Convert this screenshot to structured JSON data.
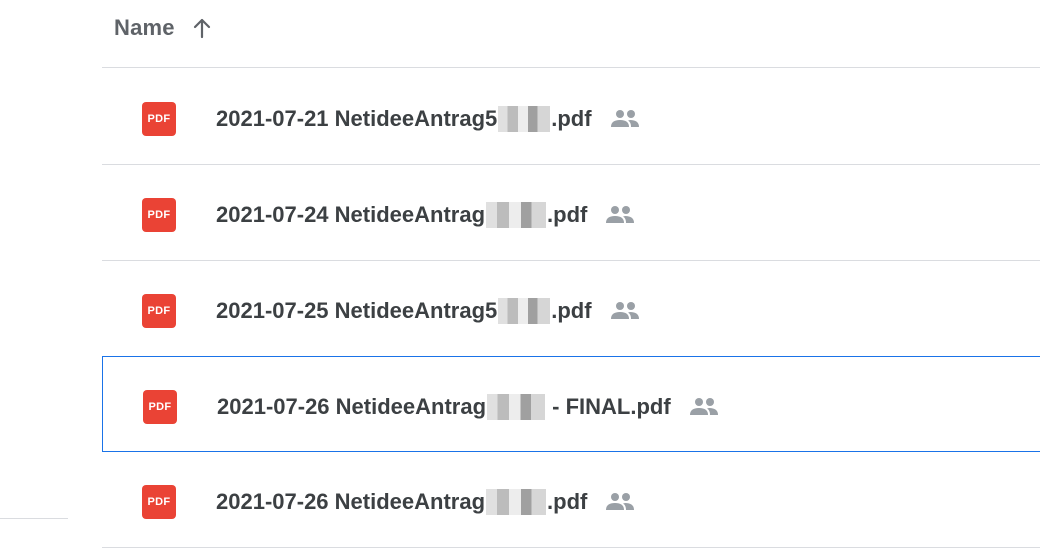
{
  "header": {
    "sort_label": "Name",
    "sort_icon": "arrow-up-icon"
  },
  "files": [
    {
      "prefix": "2021-07-21 NetideeAntrag5",
      "suffix": ".pdf",
      "type_label": "PDF",
      "shared": true,
      "selected": false
    },
    {
      "prefix": "2021-07-24 NetideeAntrag",
      "suffix": ".pdf",
      "type_label": "PDF",
      "shared": true,
      "selected": false
    },
    {
      "prefix": "2021-07-25 NetideeAntrag5",
      "suffix": ".pdf",
      "type_label": "PDF",
      "shared": true,
      "selected": false
    },
    {
      "prefix": "2021-07-26 NetideeAntrag",
      "suffix": " - FINAL.pdf",
      "type_label": "PDF",
      "shared": true,
      "selected": true
    },
    {
      "prefix": "2021-07-26 NetideeAntrag",
      "suffix": ".pdf",
      "type_label": "PDF",
      "shared": true,
      "selected": false
    }
  ],
  "colors": {
    "pdf_red": "#ea4335",
    "selection_blue": "#1a73e8",
    "text": "#3c4043",
    "icon_gray": "#9aa0a6",
    "divider": "#dadce0"
  }
}
